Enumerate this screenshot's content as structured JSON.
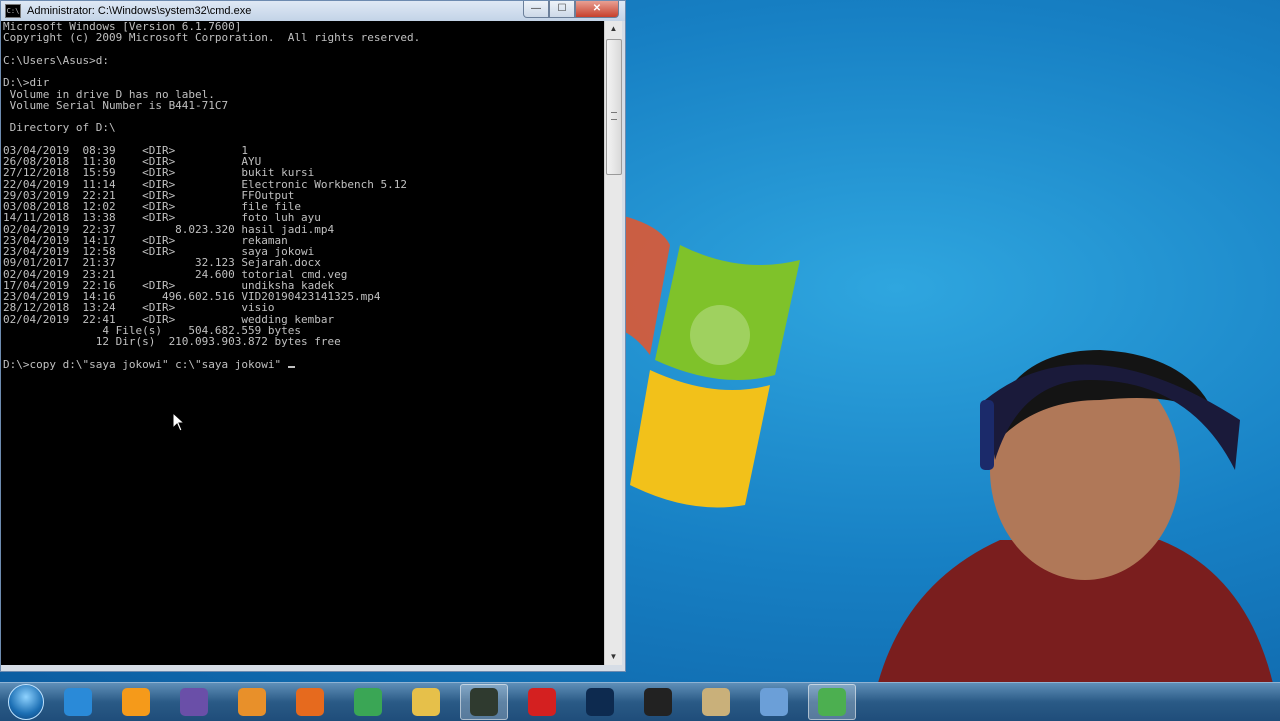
{
  "window": {
    "title": "Administrator: C:\\Windows\\system32\\cmd.exe",
    "icon_label": "C:\\",
    "buttons": {
      "minimize": "—",
      "maximize": "☐",
      "close": "✕"
    }
  },
  "console": {
    "lines": [
      "Microsoft Windows [Version 6.1.7600]",
      "Copyright (c) 2009 Microsoft Corporation.  All rights reserved.",
      "",
      "C:\\Users\\Asus>d:",
      "",
      "D:\\>dir",
      " Volume in drive D has no label.",
      " Volume Serial Number is B441-71C7",
      "",
      " Directory of D:\\",
      "",
      "03/04/2019  08:39    <DIR>          1",
      "26/08/2018  11:30    <DIR>          AYU",
      "27/12/2018  15:59    <DIR>          bukit kursi",
      "22/04/2019  11:14    <DIR>          Electronic Workbench 5.12",
      "29/03/2019  22:21    <DIR>          FFOutput",
      "03/08/2018  12:02    <DIR>          file file",
      "14/11/2018  13:38    <DIR>          foto luh ayu",
      "02/04/2019  22:37         8.023.320 hasil jadi.mp4",
      "23/04/2019  14:17    <DIR>          rekaman",
      "23/04/2019  12:58    <DIR>          saya jokowi",
      "09/01/2017  21:37            32.123 Sejarah.docx",
      "02/04/2019  23:21            24.600 totorial cmd.veg",
      "17/04/2019  22:16    <DIR>          undiksha kadek",
      "23/04/2019  14:16       496.602.516 VID20190423141325.mp4",
      "28/12/2018  13:24    <DIR>          visio",
      "02/04/2019  22:41    <DIR>          wedding kembar",
      "               4 File(s)    504.682.559 bytes",
      "              12 Dir(s)  210.093.903.872 bytes free",
      ""
    ],
    "prompt_line": "D:\\>copy d:\\\"saya jokowi\" c:\\\"saya jokowi\" "
  },
  "taskbar": {
    "items": [
      {
        "name": "internet-explorer-icon",
        "color": "#2a8ad8"
      },
      {
        "name": "media-player-orb-icon",
        "color": "#f59a1a"
      },
      {
        "name": "visual-studio-icon",
        "color": "#6a4fa8"
      },
      {
        "name": "media-player-icon",
        "color": "#e8902a"
      },
      {
        "name": "firefox-icon",
        "color": "#e66a1e"
      },
      {
        "name": "chrome-icon",
        "color": "#3aa655"
      },
      {
        "name": "file-explorer-icon",
        "color": "#e6c04a"
      },
      {
        "name": "command-prompt-icon",
        "color": "#2f3a2f"
      },
      {
        "name": "garena-icon",
        "color": "#d42020"
      },
      {
        "name": "photoshop-icon",
        "color": "#0d2a4f"
      },
      {
        "name": "video-editor-icon",
        "color": "#222222"
      },
      {
        "name": "paint-icon",
        "color": "#c9b07a"
      },
      {
        "name": "chrome-canary-icon",
        "color": "#6b9fd8"
      },
      {
        "name": "recorder-icon",
        "color": "#4caf50"
      }
    ]
  }
}
